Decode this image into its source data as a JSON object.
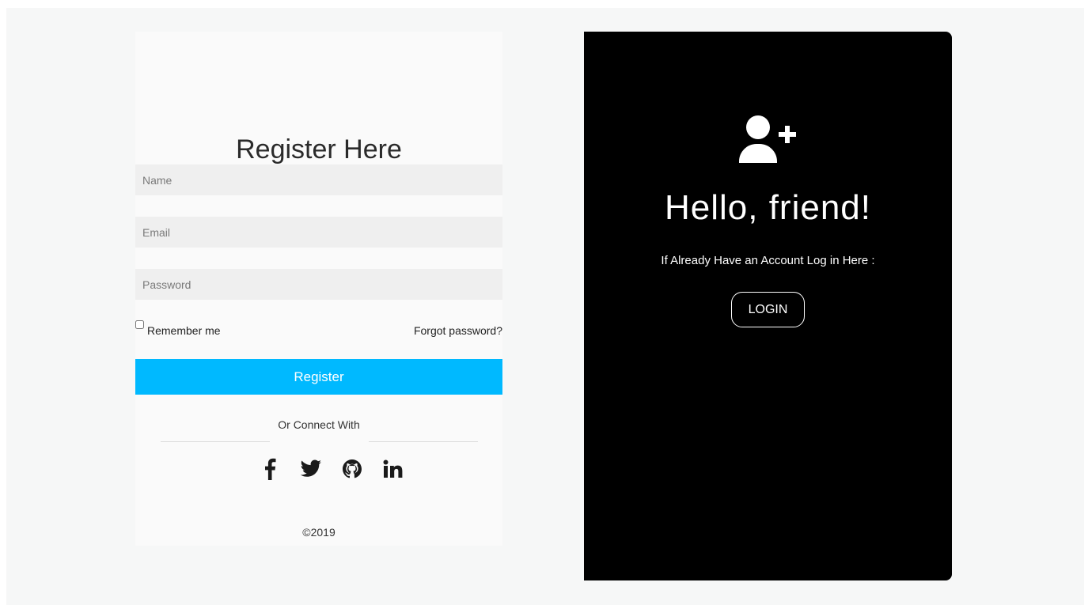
{
  "register": {
    "title": "Register Here",
    "name_placeholder": "Name",
    "email_placeholder": "Email",
    "password_placeholder": "Password",
    "remember_label": "Remember me",
    "forgot_label": "Forgot password?",
    "register_label": "Register",
    "connect_label": "Or Connect With",
    "copyright": "©2019"
  },
  "socials": [
    {
      "icon": "facebook-icon"
    },
    {
      "icon": "twitter-icon"
    },
    {
      "icon": "github-icon"
    },
    {
      "icon": "linkedin-icon"
    }
  ],
  "login": {
    "icon": "user-plus-icon",
    "greeting": "Hello, friend!",
    "message": "If Already Have an Account Log in Here :",
    "login_label": "LOGIN"
  },
  "colors": {
    "accent": "#00b9ff",
    "panel_dark": "#000000"
  }
}
